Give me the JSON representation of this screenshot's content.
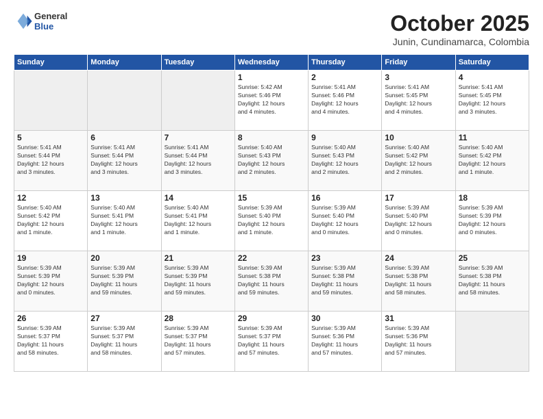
{
  "header": {
    "logo_general": "General",
    "logo_blue": "Blue",
    "month": "October 2025",
    "location": "Junin, Cundinamarca, Colombia"
  },
  "weekdays": [
    "Sunday",
    "Monday",
    "Tuesday",
    "Wednesday",
    "Thursday",
    "Friday",
    "Saturday"
  ],
  "weeks": [
    [
      {
        "day": "",
        "text": ""
      },
      {
        "day": "",
        "text": ""
      },
      {
        "day": "",
        "text": ""
      },
      {
        "day": "1",
        "text": "Sunrise: 5:42 AM\nSunset: 5:46 PM\nDaylight: 12 hours\nand 4 minutes."
      },
      {
        "day": "2",
        "text": "Sunrise: 5:41 AM\nSunset: 5:46 PM\nDaylight: 12 hours\nand 4 minutes."
      },
      {
        "day": "3",
        "text": "Sunrise: 5:41 AM\nSunset: 5:45 PM\nDaylight: 12 hours\nand 4 minutes."
      },
      {
        "day": "4",
        "text": "Sunrise: 5:41 AM\nSunset: 5:45 PM\nDaylight: 12 hours\nand 3 minutes."
      }
    ],
    [
      {
        "day": "5",
        "text": "Sunrise: 5:41 AM\nSunset: 5:44 PM\nDaylight: 12 hours\nand 3 minutes."
      },
      {
        "day": "6",
        "text": "Sunrise: 5:41 AM\nSunset: 5:44 PM\nDaylight: 12 hours\nand 3 minutes."
      },
      {
        "day": "7",
        "text": "Sunrise: 5:41 AM\nSunset: 5:44 PM\nDaylight: 12 hours\nand 3 minutes."
      },
      {
        "day": "8",
        "text": "Sunrise: 5:40 AM\nSunset: 5:43 PM\nDaylight: 12 hours\nand 2 minutes."
      },
      {
        "day": "9",
        "text": "Sunrise: 5:40 AM\nSunset: 5:43 PM\nDaylight: 12 hours\nand 2 minutes."
      },
      {
        "day": "10",
        "text": "Sunrise: 5:40 AM\nSunset: 5:42 PM\nDaylight: 12 hours\nand 2 minutes."
      },
      {
        "day": "11",
        "text": "Sunrise: 5:40 AM\nSunset: 5:42 PM\nDaylight: 12 hours\nand 1 minute."
      }
    ],
    [
      {
        "day": "12",
        "text": "Sunrise: 5:40 AM\nSunset: 5:42 PM\nDaylight: 12 hours\nand 1 minute."
      },
      {
        "day": "13",
        "text": "Sunrise: 5:40 AM\nSunset: 5:41 PM\nDaylight: 12 hours\nand 1 minute."
      },
      {
        "day": "14",
        "text": "Sunrise: 5:40 AM\nSunset: 5:41 PM\nDaylight: 12 hours\nand 1 minute."
      },
      {
        "day": "15",
        "text": "Sunrise: 5:39 AM\nSunset: 5:40 PM\nDaylight: 12 hours\nand 1 minute."
      },
      {
        "day": "16",
        "text": "Sunrise: 5:39 AM\nSunset: 5:40 PM\nDaylight: 12 hours\nand 0 minutes."
      },
      {
        "day": "17",
        "text": "Sunrise: 5:39 AM\nSunset: 5:40 PM\nDaylight: 12 hours\nand 0 minutes."
      },
      {
        "day": "18",
        "text": "Sunrise: 5:39 AM\nSunset: 5:39 PM\nDaylight: 12 hours\nand 0 minutes."
      }
    ],
    [
      {
        "day": "19",
        "text": "Sunrise: 5:39 AM\nSunset: 5:39 PM\nDaylight: 12 hours\nand 0 minutes."
      },
      {
        "day": "20",
        "text": "Sunrise: 5:39 AM\nSunset: 5:39 PM\nDaylight: 11 hours\nand 59 minutes."
      },
      {
        "day": "21",
        "text": "Sunrise: 5:39 AM\nSunset: 5:39 PM\nDaylight: 11 hours\nand 59 minutes."
      },
      {
        "day": "22",
        "text": "Sunrise: 5:39 AM\nSunset: 5:38 PM\nDaylight: 11 hours\nand 59 minutes."
      },
      {
        "day": "23",
        "text": "Sunrise: 5:39 AM\nSunset: 5:38 PM\nDaylight: 11 hours\nand 59 minutes."
      },
      {
        "day": "24",
        "text": "Sunrise: 5:39 AM\nSunset: 5:38 PM\nDaylight: 11 hours\nand 58 minutes."
      },
      {
        "day": "25",
        "text": "Sunrise: 5:39 AM\nSunset: 5:38 PM\nDaylight: 11 hours\nand 58 minutes."
      }
    ],
    [
      {
        "day": "26",
        "text": "Sunrise: 5:39 AM\nSunset: 5:37 PM\nDaylight: 11 hours\nand 58 minutes."
      },
      {
        "day": "27",
        "text": "Sunrise: 5:39 AM\nSunset: 5:37 PM\nDaylight: 11 hours\nand 58 minutes."
      },
      {
        "day": "28",
        "text": "Sunrise: 5:39 AM\nSunset: 5:37 PM\nDaylight: 11 hours\nand 57 minutes."
      },
      {
        "day": "29",
        "text": "Sunrise: 5:39 AM\nSunset: 5:37 PM\nDaylight: 11 hours\nand 57 minutes."
      },
      {
        "day": "30",
        "text": "Sunrise: 5:39 AM\nSunset: 5:36 PM\nDaylight: 11 hours\nand 57 minutes."
      },
      {
        "day": "31",
        "text": "Sunrise: 5:39 AM\nSunset: 5:36 PM\nDaylight: 11 hours\nand 57 minutes."
      },
      {
        "day": "",
        "text": ""
      }
    ]
  ]
}
